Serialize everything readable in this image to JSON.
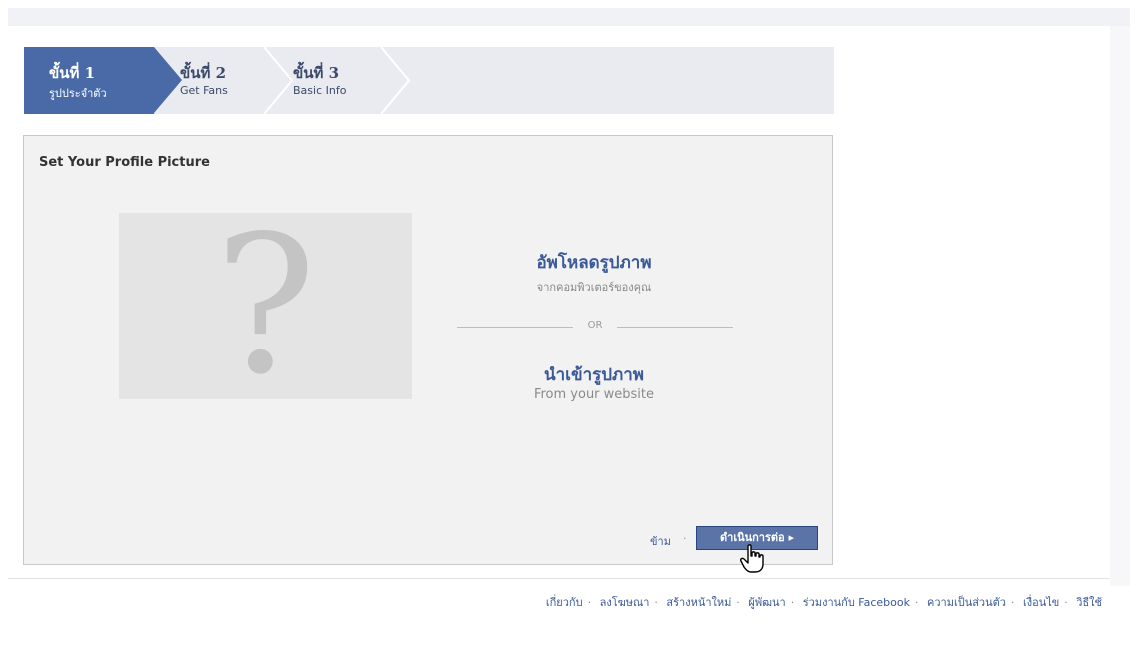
{
  "steps": [
    {
      "title": "ขั้นที่ 1",
      "subtitle": "รูปประจำตัว",
      "active": true
    },
    {
      "title": "ขั้นที่ 2",
      "subtitle": "Get Fans",
      "active": false
    },
    {
      "title": "ขั้นที่ 3",
      "subtitle": "Basic Info",
      "active": false
    }
  ],
  "panel": {
    "title": "Set Your Profile Picture",
    "placeholder_glyph": "?",
    "upload": {
      "title": "อัพโหลดรูปภาพ",
      "subtitle": "จากคอมพิวเตอร์ของคุณ"
    },
    "or_label": "OR",
    "import": {
      "title": "นำเข้ารูปภาพ",
      "subtitle": "From your website"
    },
    "skip_label": "ข้าม",
    "skip_separator": "·",
    "continue_label": "ดำเนินการต่อ ▸"
  },
  "footer": {
    "links": [
      "เกี่ยวกับ",
      "ลงโฆษณา",
      "สร้างหน้าใหม่",
      "ผู้พัฒนา",
      "ร่วมงานกับ Facebook",
      "ความเป็นส่วนตัว",
      "เงื่อนไข",
      "วิธีใช้"
    ]
  },
  "colors": {
    "accent": "#3b5998",
    "active_step": "#4a6aa7",
    "steps_bg": "#e9ebf0",
    "panel_bg": "#f2f2f2",
    "button": "#5b74a8"
  },
  "icons": {
    "cursor": "hand-pointer-icon",
    "placeholder": "question-mark-icon"
  }
}
